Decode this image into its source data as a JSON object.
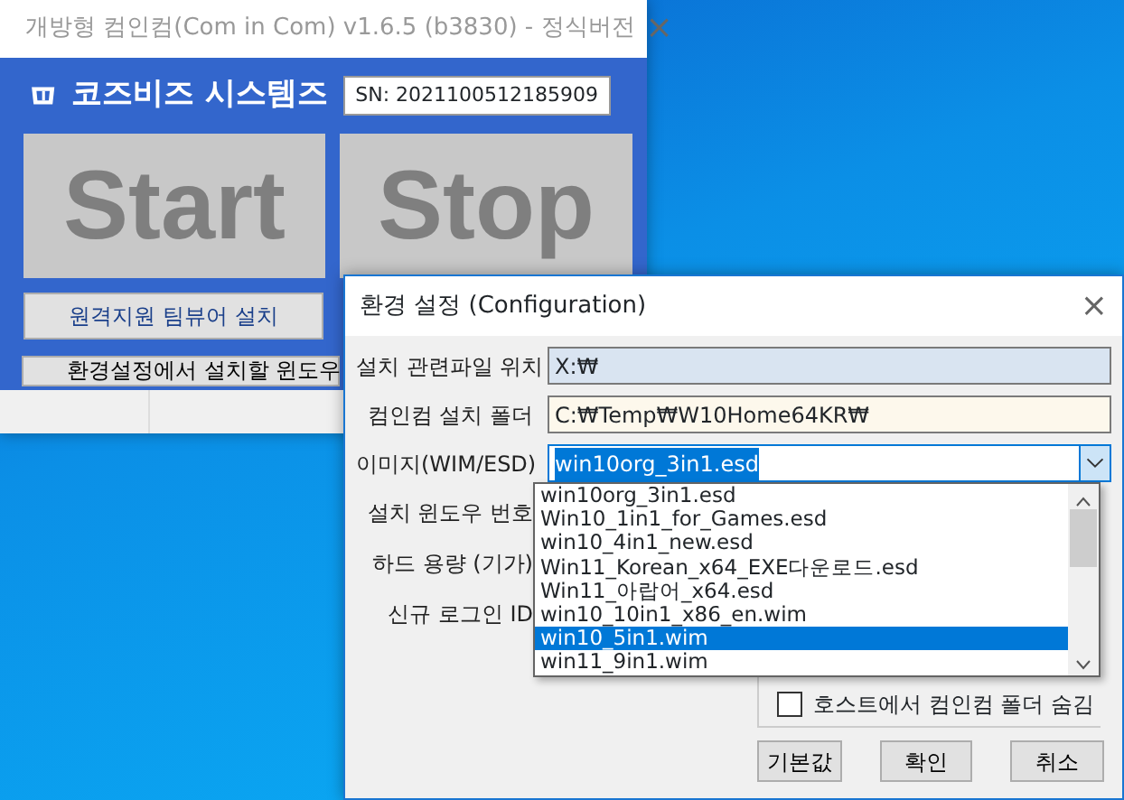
{
  "main_window": {
    "title": "개방형 컴인컴(Com in Com) v1.6.5 (b3830) - 정식버전",
    "close": "×",
    "brand": "코즈비즈 시스템즈",
    "serial": "SN: 2021100512185909",
    "big_buttons": [
      "Start",
      "Stop"
    ],
    "teamviewer_button": "원격지원 팀뷰어 설치",
    "notice_button": "환경설정에서 설치할 윈도우"
  },
  "dialog": {
    "title": "환경 설정 (Configuration)",
    "close": "×",
    "fields": [
      {
        "kind": "text",
        "label": "설치 관련파일 위치",
        "value": "X:₩",
        "color": "#d9e4f1"
      },
      {
        "kind": "text",
        "label": "컴인컴 설치 폴더",
        "value": "C:₩Temp₩W10Home64KR₩",
        "color": "#fdf8ec"
      },
      {
        "kind": "combo",
        "label": "이미지(WIM/ESD)",
        "value": "win10org_3in1.esd",
        "expanded": true
      },
      {
        "kind": "hidden",
        "label": "설치 윈도우 번호"
      },
      {
        "kind": "hidden",
        "label": "하드 용량 (기가)"
      },
      {
        "kind": "hidden",
        "label": "신규 로그인 ID"
      }
    ],
    "dropdown_options": [
      {
        "label": "win10org_3in1.esd",
        "selected": false
      },
      {
        "label": "Win10_1in1_for_Games.esd",
        "selected": false
      },
      {
        "label": "win10_4in1_new.esd",
        "selected": false
      },
      {
        "label": "Win11_Korean_x64_EXE다운로드.esd",
        "selected": false
      },
      {
        "label": "Win11_아랍어_x64.esd",
        "selected": false
      },
      {
        "label": "win10_10in1_x86_en.wim",
        "selected": false
      },
      {
        "label": "win10_5in1.wim",
        "selected": true
      },
      {
        "label": "win11_9in1.wim",
        "selected": false
      }
    ],
    "checkboxes": [
      {
        "label": "호스트에서 컴인컴 폴더 숨김",
        "checked": false
      }
    ],
    "buttons": [
      "기본값",
      "확인",
      "취소"
    ]
  }
}
